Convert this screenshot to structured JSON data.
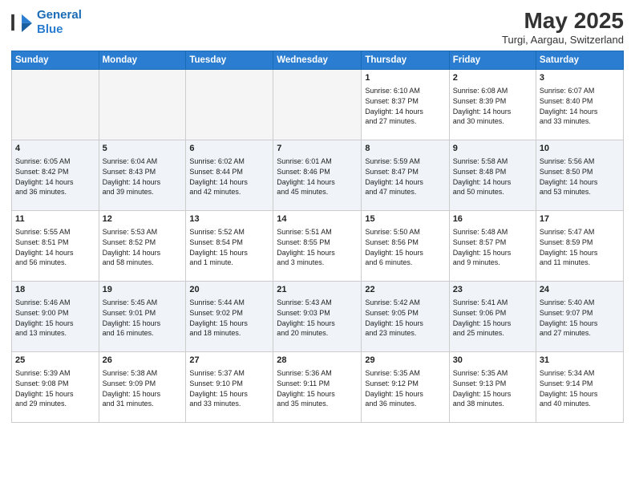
{
  "header": {
    "logo_line1": "General",
    "logo_line2": "Blue",
    "title": "May 2025",
    "subtitle": "Turgi, Aargau, Switzerland"
  },
  "weekdays": [
    "Sunday",
    "Monday",
    "Tuesday",
    "Wednesday",
    "Thursday",
    "Friday",
    "Saturday"
  ],
  "weeks": [
    {
      "row_class": "odd",
      "days": [
        {
          "num": "",
          "content": ""
        },
        {
          "num": "",
          "content": ""
        },
        {
          "num": "",
          "content": ""
        },
        {
          "num": "",
          "content": ""
        },
        {
          "num": "1",
          "content": "Sunrise: 6:10 AM\nSunset: 8:37 PM\nDaylight: 14 hours\nand 27 minutes."
        },
        {
          "num": "2",
          "content": "Sunrise: 6:08 AM\nSunset: 8:39 PM\nDaylight: 14 hours\nand 30 minutes."
        },
        {
          "num": "3",
          "content": "Sunrise: 6:07 AM\nSunset: 8:40 PM\nDaylight: 14 hours\nand 33 minutes."
        }
      ]
    },
    {
      "row_class": "even",
      "days": [
        {
          "num": "4",
          "content": "Sunrise: 6:05 AM\nSunset: 8:42 PM\nDaylight: 14 hours\nand 36 minutes."
        },
        {
          "num": "5",
          "content": "Sunrise: 6:04 AM\nSunset: 8:43 PM\nDaylight: 14 hours\nand 39 minutes."
        },
        {
          "num": "6",
          "content": "Sunrise: 6:02 AM\nSunset: 8:44 PM\nDaylight: 14 hours\nand 42 minutes."
        },
        {
          "num": "7",
          "content": "Sunrise: 6:01 AM\nSunset: 8:46 PM\nDaylight: 14 hours\nand 45 minutes."
        },
        {
          "num": "8",
          "content": "Sunrise: 5:59 AM\nSunset: 8:47 PM\nDaylight: 14 hours\nand 47 minutes."
        },
        {
          "num": "9",
          "content": "Sunrise: 5:58 AM\nSunset: 8:48 PM\nDaylight: 14 hours\nand 50 minutes."
        },
        {
          "num": "10",
          "content": "Sunrise: 5:56 AM\nSunset: 8:50 PM\nDaylight: 14 hours\nand 53 minutes."
        }
      ]
    },
    {
      "row_class": "odd",
      "days": [
        {
          "num": "11",
          "content": "Sunrise: 5:55 AM\nSunset: 8:51 PM\nDaylight: 14 hours\nand 56 minutes."
        },
        {
          "num": "12",
          "content": "Sunrise: 5:53 AM\nSunset: 8:52 PM\nDaylight: 14 hours\nand 58 minutes."
        },
        {
          "num": "13",
          "content": "Sunrise: 5:52 AM\nSunset: 8:54 PM\nDaylight: 15 hours\nand 1 minute."
        },
        {
          "num": "14",
          "content": "Sunrise: 5:51 AM\nSunset: 8:55 PM\nDaylight: 15 hours\nand 3 minutes."
        },
        {
          "num": "15",
          "content": "Sunrise: 5:50 AM\nSunset: 8:56 PM\nDaylight: 15 hours\nand 6 minutes."
        },
        {
          "num": "16",
          "content": "Sunrise: 5:48 AM\nSunset: 8:57 PM\nDaylight: 15 hours\nand 9 minutes."
        },
        {
          "num": "17",
          "content": "Sunrise: 5:47 AM\nSunset: 8:59 PM\nDaylight: 15 hours\nand 11 minutes."
        }
      ]
    },
    {
      "row_class": "even",
      "days": [
        {
          "num": "18",
          "content": "Sunrise: 5:46 AM\nSunset: 9:00 PM\nDaylight: 15 hours\nand 13 minutes."
        },
        {
          "num": "19",
          "content": "Sunrise: 5:45 AM\nSunset: 9:01 PM\nDaylight: 15 hours\nand 16 minutes."
        },
        {
          "num": "20",
          "content": "Sunrise: 5:44 AM\nSunset: 9:02 PM\nDaylight: 15 hours\nand 18 minutes."
        },
        {
          "num": "21",
          "content": "Sunrise: 5:43 AM\nSunset: 9:03 PM\nDaylight: 15 hours\nand 20 minutes."
        },
        {
          "num": "22",
          "content": "Sunrise: 5:42 AM\nSunset: 9:05 PM\nDaylight: 15 hours\nand 23 minutes."
        },
        {
          "num": "23",
          "content": "Sunrise: 5:41 AM\nSunset: 9:06 PM\nDaylight: 15 hours\nand 25 minutes."
        },
        {
          "num": "24",
          "content": "Sunrise: 5:40 AM\nSunset: 9:07 PM\nDaylight: 15 hours\nand 27 minutes."
        }
      ]
    },
    {
      "row_class": "odd",
      "days": [
        {
          "num": "25",
          "content": "Sunrise: 5:39 AM\nSunset: 9:08 PM\nDaylight: 15 hours\nand 29 minutes."
        },
        {
          "num": "26",
          "content": "Sunrise: 5:38 AM\nSunset: 9:09 PM\nDaylight: 15 hours\nand 31 minutes."
        },
        {
          "num": "27",
          "content": "Sunrise: 5:37 AM\nSunset: 9:10 PM\nDaylight: 15 hours\nand 33 minutes."
        },
        {
          "num": "28",
          "content": "Sunrise: 5:36 AM\nSunset: 9:11 PM\nDaylight: 15 hours\nand 35 minutes."
        },
        {
          "num": "29",
          "content": "Sunrise: 5:35 AM\nSunset: 9:12 PM\nDaylight: 15 hours\nand 36 minutes."
        },
        {
          "num": "30",
          "content": "Sunrise: 5:35 AM\nSunset: 9:13 PM\nDaylight: 15 hours\nand 38 minutes."
        },
        {
          "num": "31",
          "content": "Sunrise: 5:34 AM\nSunset: 9:14 PM\nDaylight: 15 hours\nand 40 minutes."
        }
      ]
    }
  ]
}
